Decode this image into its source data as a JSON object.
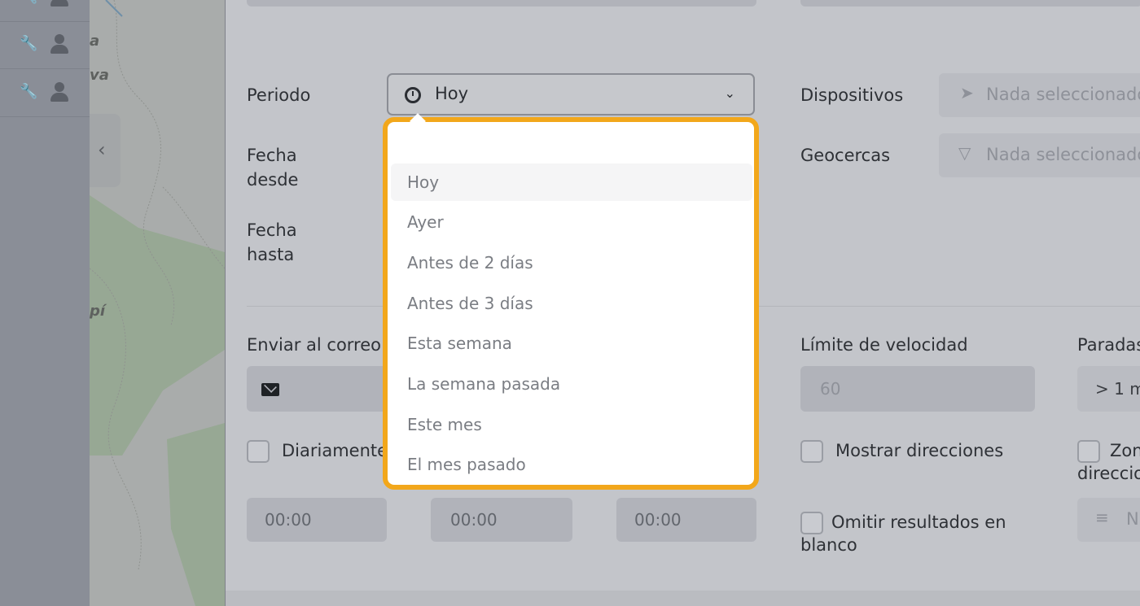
{
  "map": {
    "labels": [
      "a",
      "va",
      "pí"
    ]
  },
  "form": {
    "periodo_label": "Periodo",
    "period_value": "Hoy",
    "fecha_desde_line1": "Fecha",
    "fecha_desde_line2": "desde",
    "fecha_hasta_line1": "Fecha",
    "fecha_hasta_line2": "hasta",
    "dispositivos_label": "Dispositivos",
    "dispositivos_placeholder": "Nada seleccionado",
    "geocercas_label": "Geocercas",
    "geocercas_placeholder": "Nada seleccionado",
    "enviar_correo_label": "Enviar al correo e",
    "diariamente_label": "Diariamente",
    "limite_velocidad_label": "Límite de velocidad",
    "limite_velocidad_value": "60",
    "paradas_label": "Paradas",
    "paradas_value": "> 1 m",
    "mostrar_direcciones_label": "Mostrar direcciones",
    "zona_line1": "Zon",
    "zona_line2": "direccio",
    "omitir_line1": "Omitir resultados en",
    "omitir_line2": "blanco",
    "time1": "00:00",
    "time2": "00:00",
    "time3": "00:00",
    "last_placeholder": "N"
  },
  "dropdown": {
    "options": [
      "Hoy",
      "Ayer",
      "Antes de 2 días",
      "Antes de 3 días",
      "Esta semana",
      "La semana pasada",
      "Este mes",
      "El mes pasado"
    ],
    "selected": "Hoy"
  },
  "colors": {
    "highlight": "#f2a71b"
  }
}
